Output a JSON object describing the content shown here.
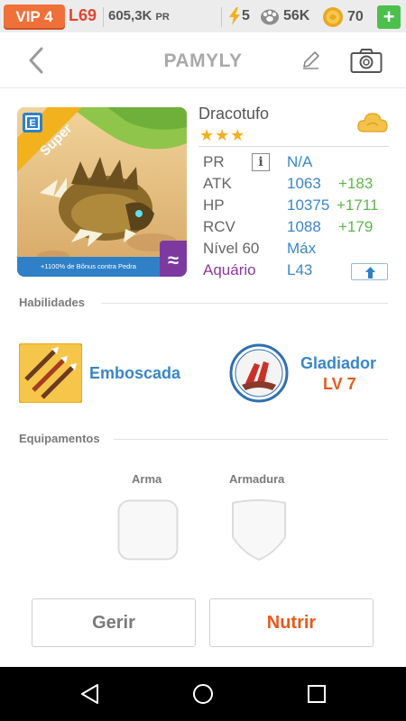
{
  "topbar": {
    "vip": "VIP 4",
    "level": "L69",
    "pr_value": "605,3K",
    "pr_unit": "PR",
    "energy": "5",
    "paws": "56K",
    "coins": "70",
    "plus": "+"
  },
  "header": {
    "title": "PAMYLY"
  },
  "pet": {
    "name": "Dracotufo",
    "stars": "★★★",
    "card_badge": "Super",
    "card_tag": "E",
    "card_bonus": "+1100% de Bônus contra Pedra",
    "element_glyph": "≈"
  },
  "stats": [
    {
      "label": "PR",
      "value": "N/A",
      "bonus": ""
    },
    {
      "label": "ATK",
      "value": "1063",
      "bonus": "+183"
    },
    {
      "label": "HP",
      "value": "10375",
      "bonus": "+1711"
    },
    {
      "label": "RCV",
      "value": "1088",
      "bonus": "+179"
    },
    {
      "label": "Nível 60",
      "value": "Máx",
      "bonus": ""
    },
    {
      "label": "Aquário",
      "value": "L43",
      "bonus": ""
    }
  ],
  "info_icon": "i",
  "habilidades": {
    "title": "Habilidades",
    "skill1": {
      "name": "Emboscada"
    },
    "skill2": {
      "name": "Gladiador",
      "level": "LV 7"
    }
  },
  "equipamentos": {
    "title": "Equipamentos",
    "weapon": "Arma",
    "armor": "Armadura"
  },
  "buttons": {
    "gerir": "Gerir",
    "nutrir": "Nutrir"
  },
  "colors": {
    "accent_blue": "#3a86c8",
    "bonus_green": "#5db84a",
    "orange": "#e85a1b",
    "vip_orange": "#f0703a"
  }
}
